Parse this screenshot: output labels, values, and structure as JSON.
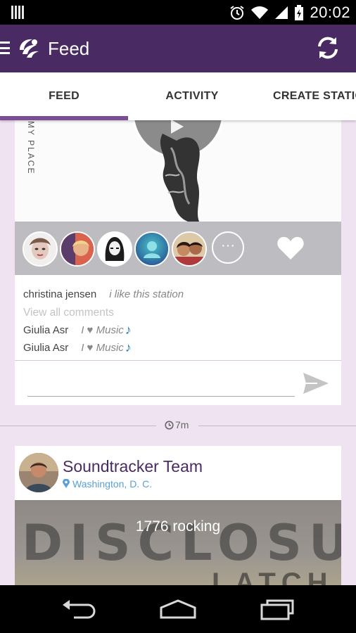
{
  "status_bar": {
    "time": "20:02"
  },
  "app_bar": {
    "title": "Feed"
  },
  "tabs": [
    {
      "label": "FEED"
    },
    {
      "label": "ACTIVITY"
    },
    {
      "label": "CREATE STATIO"
    }
  ],
  "station_card": {
    "artwork_text": "MY PLACE",
    "more_label": "···",
    "comments": [
      {
        "name": "christina jensen",
        "text": "i like this station"
      }
    ],
    "view_all": "View all comments",
    "music_comments": [
      {
        "name": "Giulia Asr",
        "text": "I ♥ Music"
      },
      {
        "name": "Giulia Asr",
        "text": "I ♥ Music"
      }
    ],
    "input_placeholder": ""
  },
  "timestamp": "7m",
  "user_card": {
    "name": "Soundtracker Team",
    "location": "Washington, D. C.",
    "cover_text": "1776 rocking",
    "cover_art_text": "DISCLOSURE",
    "cover_art_text2": "LATCH"
  },
  "colors": {
    "primary": "#4a2a63",
    "accent": "#7b4d95",
    "background": "#efe3f1",
    "link": "#5aa0d6"
  }
}
